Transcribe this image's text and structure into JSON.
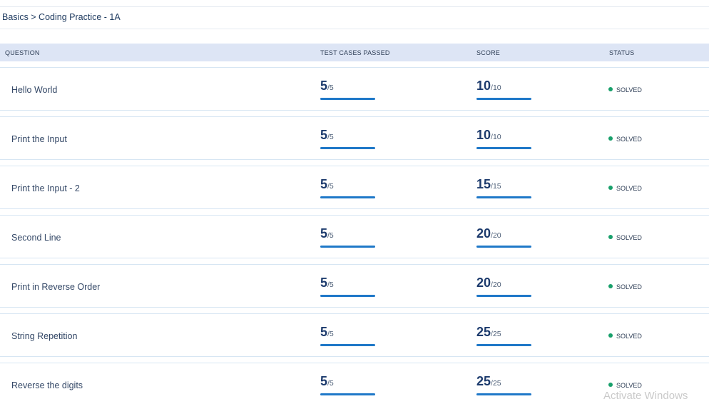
{
  "breadcrumb": "Basics > Coding Practice - 1A",
  "table": {
    "headers": {
      "question": "QUESTION",
      "test_cases": "TEST CASES PASSED",
      "score": "SCORE",
      "status": "STATUS"
    },
    "rows": [
      {
        "question": "Hello World",
        "tests_passed": "5",
        "tests_total": "/5",
        "score": "10",
        "score_total": "/10",
        "status": "SOLVED",
        "tests_progress": 1.0,
        "score_progress": 1.0
      },
      {
        "question": "Print the Input",
        "tests_passed": "5",
        "tests_total": "/5",
        "score": "10",
        "score_total": "/10",
        "status": "SOLVED",
        "tests_progress": 1.0,
        "score_progress": 1.0
      },
      {
        "question": "Print the Input - 2",
        "tests_passed": "5",
        "tests_total": "/5",
        "score": "15",
        "score_total": "/15",
        "status": "SOLVED",
        "tests_progress": 1.0,
        "score_progress": 1.0
      },
      {
        "question": "Second Line",
        "tests_passed": "5",
        "tests_total": "/5",
        "score": "20",
        "score_total": "/20",
        "status": "SOLVED",
        "tests_progress": 1.0,
        "score_progress": 1.0
      },
      {
        "question": "Print in Reverse Order",
        "tests_passed": "5",
        "tests_total": "/5",
        "score": "20",
        "score_total": "/20",
        "status": "SOLVED",
        "tests_progress": 1.0,
        "score_progress": 1.0
      },
      {
        "question": "String Repetition",
        "tests_passed": "5",
        "tests_total": "/5",
        "score": "25",
        "score_total": "/25",
        "status": "SOLVED",
        "tests_progress": 1.0,
        "score_progress": 1.0
      },
      {
        "question": "Reverse the digits",
        "tests_passed": "5",
        "tests_total": "/5",
        "score": "25",
        "score_total": "/25",
        "status": "SOLVED",
        "tests_progress": 1.0,
        "score_progress": 1.0
      }
    ]
  },
  "colors": {
    "progress_bar": "#1f78c8",
    "solved_dot": "#18a06b",
    "header_bg": "#dde5f5"
  },
  "watermark": "Activate Windows"
}
